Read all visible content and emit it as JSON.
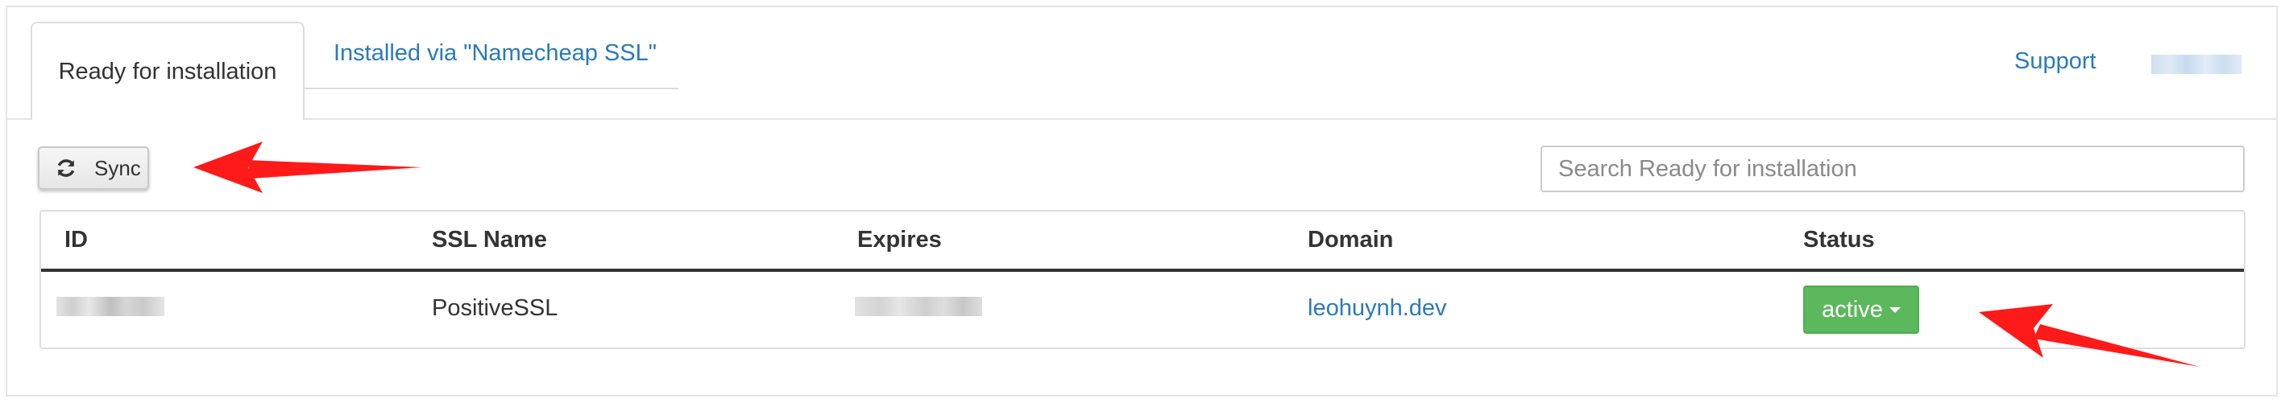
{
  "tabs": [
    {
      "label": "Ready for installation",
      "active": true
    },
    {
      "label": "Installed via \"Namecheap SSL\"",
      "active": false
    }
  ],
  "header": {
    "support_label": "Support"
  },
  "toolbar": {
    "sync_label": "Sync",
    "search_placeholder": "Search Ready for installation"
  },
  "table": {
    "columns": [
      "ID",
      "SSL Name",
      "Expires",
      "Domain",
      "Status"
    ],
    "rows": [
      {
        "id": "",
        "ssl_name": "PositiveSSL",
        "expires": "",
        "domain": "leohuynh.dev",
        "status": "active"
      }
    ]
  },
  "colors": {
    "link": "#2a7ab8",
    "status_active": "#5cb85c",
    "annotation_arrow": "#ff0000"
  },
  "icons": {
    "sync": "refresh-icon",
    "status_dropdown": "caret-down-icon"
  }
}
